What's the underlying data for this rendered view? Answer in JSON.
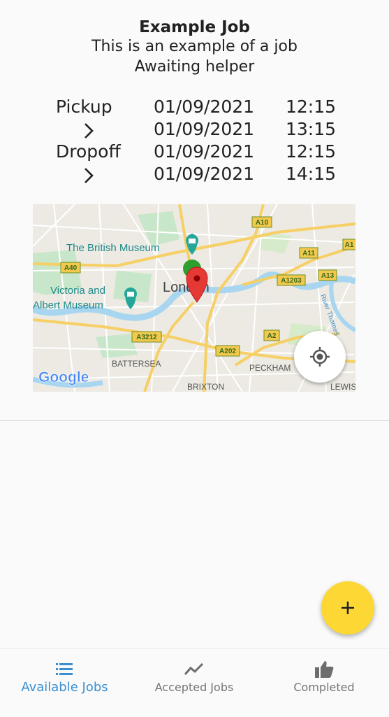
{
  "job": {
    "title": "Example Job",
    "description": "This is an example of a job",
    "status": "Awaiting helper"
  },
  "schedule": [
    {
      "label": "Pickup",
      "date": "01/09/2021",
      "time": "12:15"
    },
    {
      "label": "",
      "icon": "chevron-right-icon",
      "date": "01/09/2021",
      "time": "13:15"
    },
    {
      "label": "Dropoff",
      "date": "01/09/2021",
      "time": "12:15"
    },
    {
      "label": "",
      "icon": "chevron-right-icon",
      "date": "01/09/2021",
      "time": "14:15"
    }
  ],
  "map": {
    "labels": {
      "british_museum": "The British Museum",
      "victoria_albert_1": "Victoria and",
      "victoria_albert_2": "Albert Museum",
      "london": "London",
      "battersea": "BATTERSEA",
      "brixton": "BRIXTON",
      "peckham": "PECKHAM",
      "lewisham": "LEWIS",
      "river_thames": "River Thames",
      "google": "Google"
    },
    "road_badges": [
      "A10",
      "A11",
      "A1",
      "A40",
      "A1203",
      "A13",
      "A3212",
      "A2",
      "A202"
    ],
    "markers": [
      {
        "name": "pickup-marker",
        "color": "#2e9e2e"
      },
      {
        "name": "dropoff-marker",
        "color": "#e53935"
      }
    ]
  },
  "fab": {
    "icon": "plus-icon",
    "color": "#fdd835"
  },
  "bottom_nav": {
    "items": [
      {
        "label": "Available Jobs",
        "icon": "list-icon",
        "active": true
      },
      {
        "label": "Accepted Jobs",
        "icon": "trending-icon",
        "active": false
      },
      {
        "label": "Completed",
        "icon": "thumbs-up-icon",
        "active": false
      }
    ],
    "active_color": "#3a8fd1",
    "inactive_color": "#757575"
  }
}
